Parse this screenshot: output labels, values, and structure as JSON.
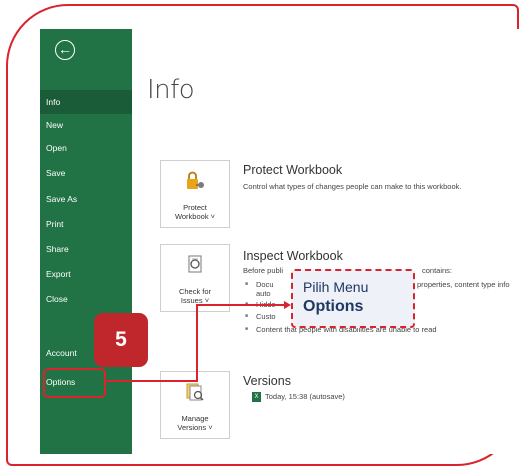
{
  "sidebar": {
    "back_icon": "arrow-left-circle-icon",
    "items": [
      {
        "label": "Info"
      },
      {
        "label": "New"
      },
      {
        "label": "Open"
      },
      {
        "label": "Save"
      },
      {
        "label": "Save As"
      },
      {
        "label": "Print"
      },
      {
        "label": "Share"
      },
      {
        "label": "Export"
      },
      {
        "label": "Close"
      },
      {
        "label": "Account"
      },
      {
        "label": "Options"
      }
    ],
    "accent": "#217346"
  },
  "main": {
    "title": "Info",
    "protect": {
      "tile_label_1": "Protect",
      "tile_label_2": "Workbook",
      "title": "Protect Workbook",
      "desc": "Control what types of changes people can make to this workbook."
    },
    "inspect": {
      "tile_label_1": "Check for",
      "tile_label_2": "Issues",
      "title": "Inspect Workbook",
      "desc_start": "Before publi",
      "desc_end": "contains:",
      "bullets": [
        {
          "text_a": "Docu",
          "text_b": "properties, content type info"
        },
        {
          "text_a": "auto"
        },
        {
          "text_a": "Hidde"
        },
        {
          "text_a": "Custo"
        },
        {
          "text_a": "Content that people with disabilities are unable to read"
        }
      ]
    },
    "versions": {
      "tile_label_1": "Manage",
      "tile_label_2": "Versions",
      "title": "Versions",
      "entry": "Today, 15:38 (autosave)"
    }
  },
  "annotation": {
    "callout_line1": "Pilih Menu",
    "callout_line2": "Options",
    "step_number": "5",
    "accent": "#d9232d"
  }
}
